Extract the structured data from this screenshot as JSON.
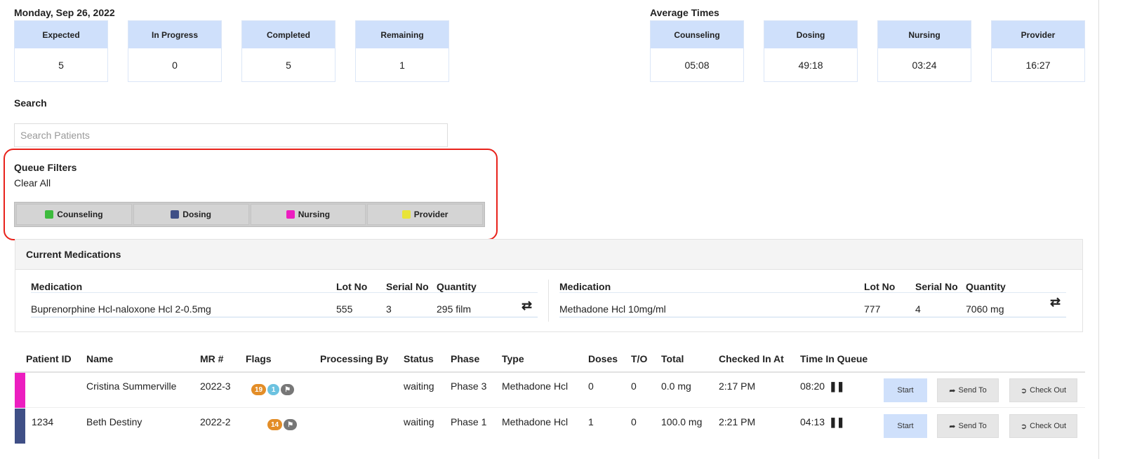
{
  "date": "Monday, Sep 26, 2022",
  "stats": [
    {
      "label": "Expected",
      "value": "5"
    },
    {
      "label": "In Progress",
      "value": "0"
    },
    {
      "label": "Completed",
      "value": "5"
    },
    {
      "label": "Remaining",
      "value": "1"
    }
  ],
  "average_times": {
    "title": "Average Times",
    "items": [
      {
        "label": "Counseling",
        "value": "05:08"
      },
      {
        "label": "Dosing",
        "value": "49:18"
      },
      {
        "label": "Nursing",
        "value": "03:24"
      },
      {
        "label": "Provider",
        "value": "16:27"
      }
    ]
  },
  "search": {
    "label": "Search",
    "placeholder": "Search Patients"
  },
  "queue_filters": {
    "title": "Queue Filters",
    "clear_all": "Clear All",
    "filters": [
      {
        "label": "Counseling",
        "color": "#3dbb3d"
      },
      {
        "label": "Dosing",
        "color": "#3f4f86"
      },
      {
        "label": "Nursing",
        "color": "#ec1ec0"
      },
      {
        "label": "Provider",
        "color": "#e8e43a"
      }
    ]
  },
  "medications": {
    "title": "Current Medications",
    "headers": [
      "Medication",
      "Lot No",
      "Serial No",
      "Quantity"
    ],
    "rows": [
      {
        "medication": "Buprenorphine Hcl-naloxone Hcl 2-0.5mg",
        "lot": "555",
        "serial": "3",
        "quantity": "295 film"
      },
      {
        "medication": "Methadone Hcl 10mg/ml",
        "lot": "777",
        "serial": "4",
        "quantity": "7060 mg"
      }
    ]
  },
  "queue": {
    "headers": [
      "Patient ID",
      "Name",
      "MR #",
      "Flags",
      "Processing By",
      "Status",
      "Phase",
      "Type",
      "Doses",
      "T/O",
      "Total",
      "Checked In At",
      "Time In Queue"
    ],
    "actions": {
      "start": "Start",
      "send_to": "Send To",
      "check_out": "Check Out"
    },
    "rows": [
      {
        "color": "#ec1ec0",
        "patient_id": "",
        "name": "Cristina Summerville",
        "mr": "2022-3",
        "flags": [
          "19",
          "1"
        ],
        "processing_by": "",
        "status": "waiting",
        "phase": "Phase 3",
        "type": "Methadone Hcl",
        "doses": "0",
        "to": "0",
        "total": "0.0 mg",
        "checked_in": "2:17 PM",
        "time_in_queue": "08:20"
      },
      {
        "color": "#3f4f86",
        "patient_id": "1234",
        "name": "Beth Destiny",
        "mr": "2022-2",
        "flags": [
          "14"
        ],
        "processing_by": "",
        "status": "waiting",
        "phase": "Phase 1",
        "type": "Methadone Hcl",
        "doses": "1",
        "to": "0",
        "total": "100.0 mg",
        "checked_in": "2:21 PM",
        "time_in_queue": "04:13"
      }
    ]
  }
}
